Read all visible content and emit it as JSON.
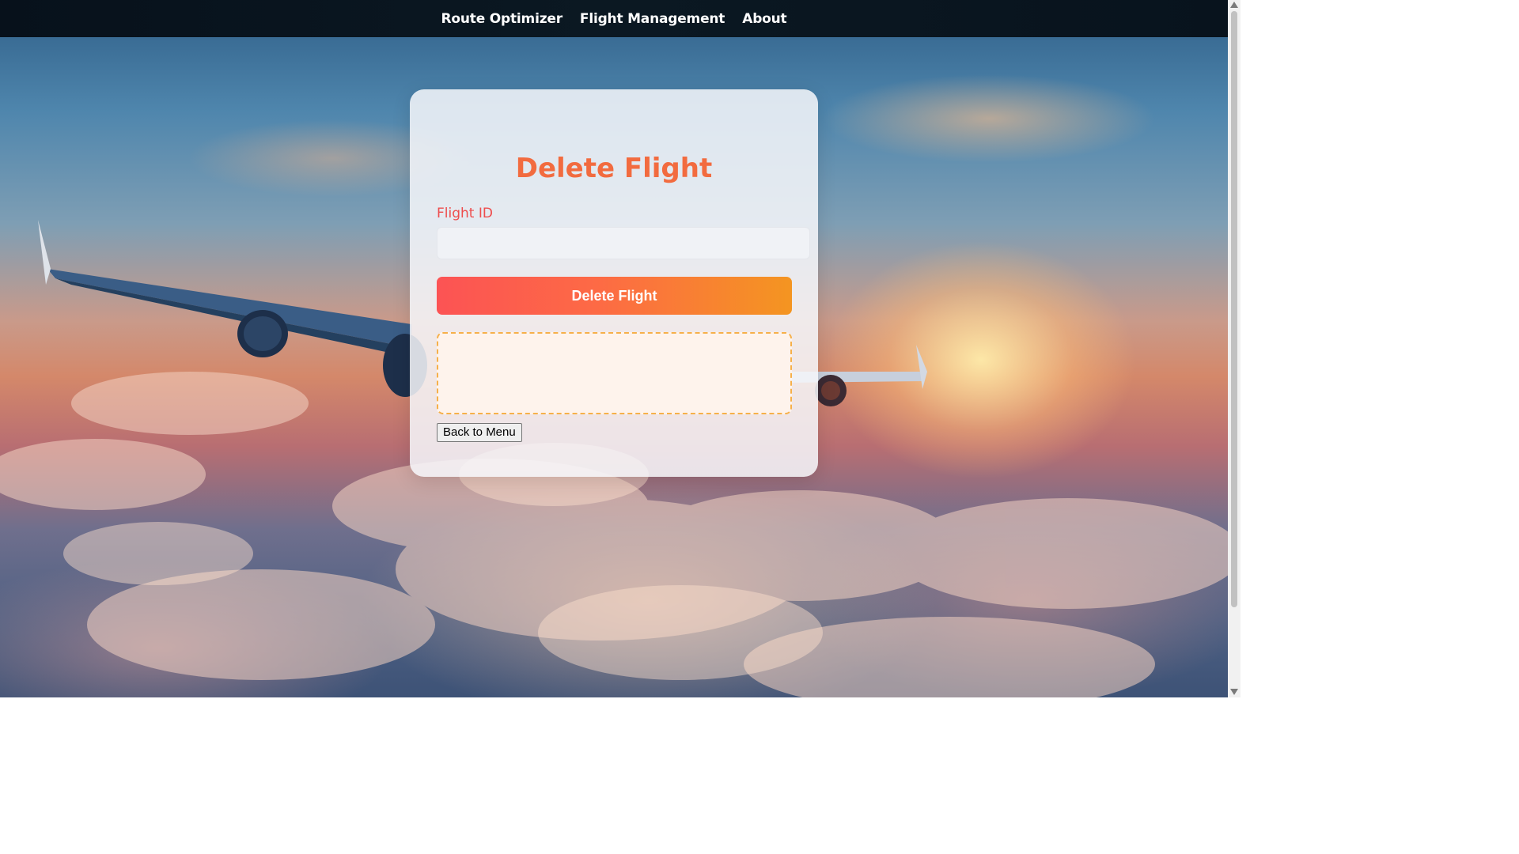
{
  "nav": {
    "links": [
      {
        "label": "Route Optimizer"
      },
      {
        "label": "Flight Management"
      },
      {
        "label": "About"
      }
    ]
  },
  "form": {
    "title": "Delete Flight",
    "flight_id_label": "Flight ID",
    "flight_id_value": "",
    "submit_label": "Delete Flight",
    "result_text": "",
    "back_label": "Back to Menu"
  },
  "colors": {
    "title": "#f26b3f",
    "label": "#ee4d4d",
    "button_gradient_start": "#fc5354",
    "button_gradient_end": "#f49521",
    "result_border": "#f6b04a"
  },
  "background": {
    "icon": "airplane-over-clouds-sunset"
  }
}
